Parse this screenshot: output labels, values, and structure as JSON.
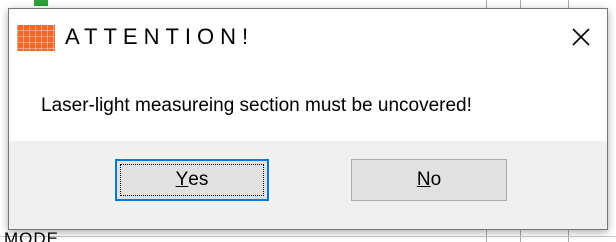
{
  "dialog": {
    "title": "ATTENTION!",
    "app_icon": "orange-grid-app-icon",
    "close_icon": "close-x-icon",
    "message": "Laser-light measureing section must be uncovered!",
    "buttons": {
      "yes": {
        "mnemonic": "Y",
        "rest": "es"
      },
      "no": {
        "mnemonic": "N",
        "rest": "o"
      }
    }
  },
  "background": {
    "peek_text": "MODE"
  },
  "colors": {
    "app_icon": "#ef6a2a",
    "focus_border": "#0078d7",
    "button_face": "#e1e1e1",
    "button_bar": "#f0f0f0"
  }
}
